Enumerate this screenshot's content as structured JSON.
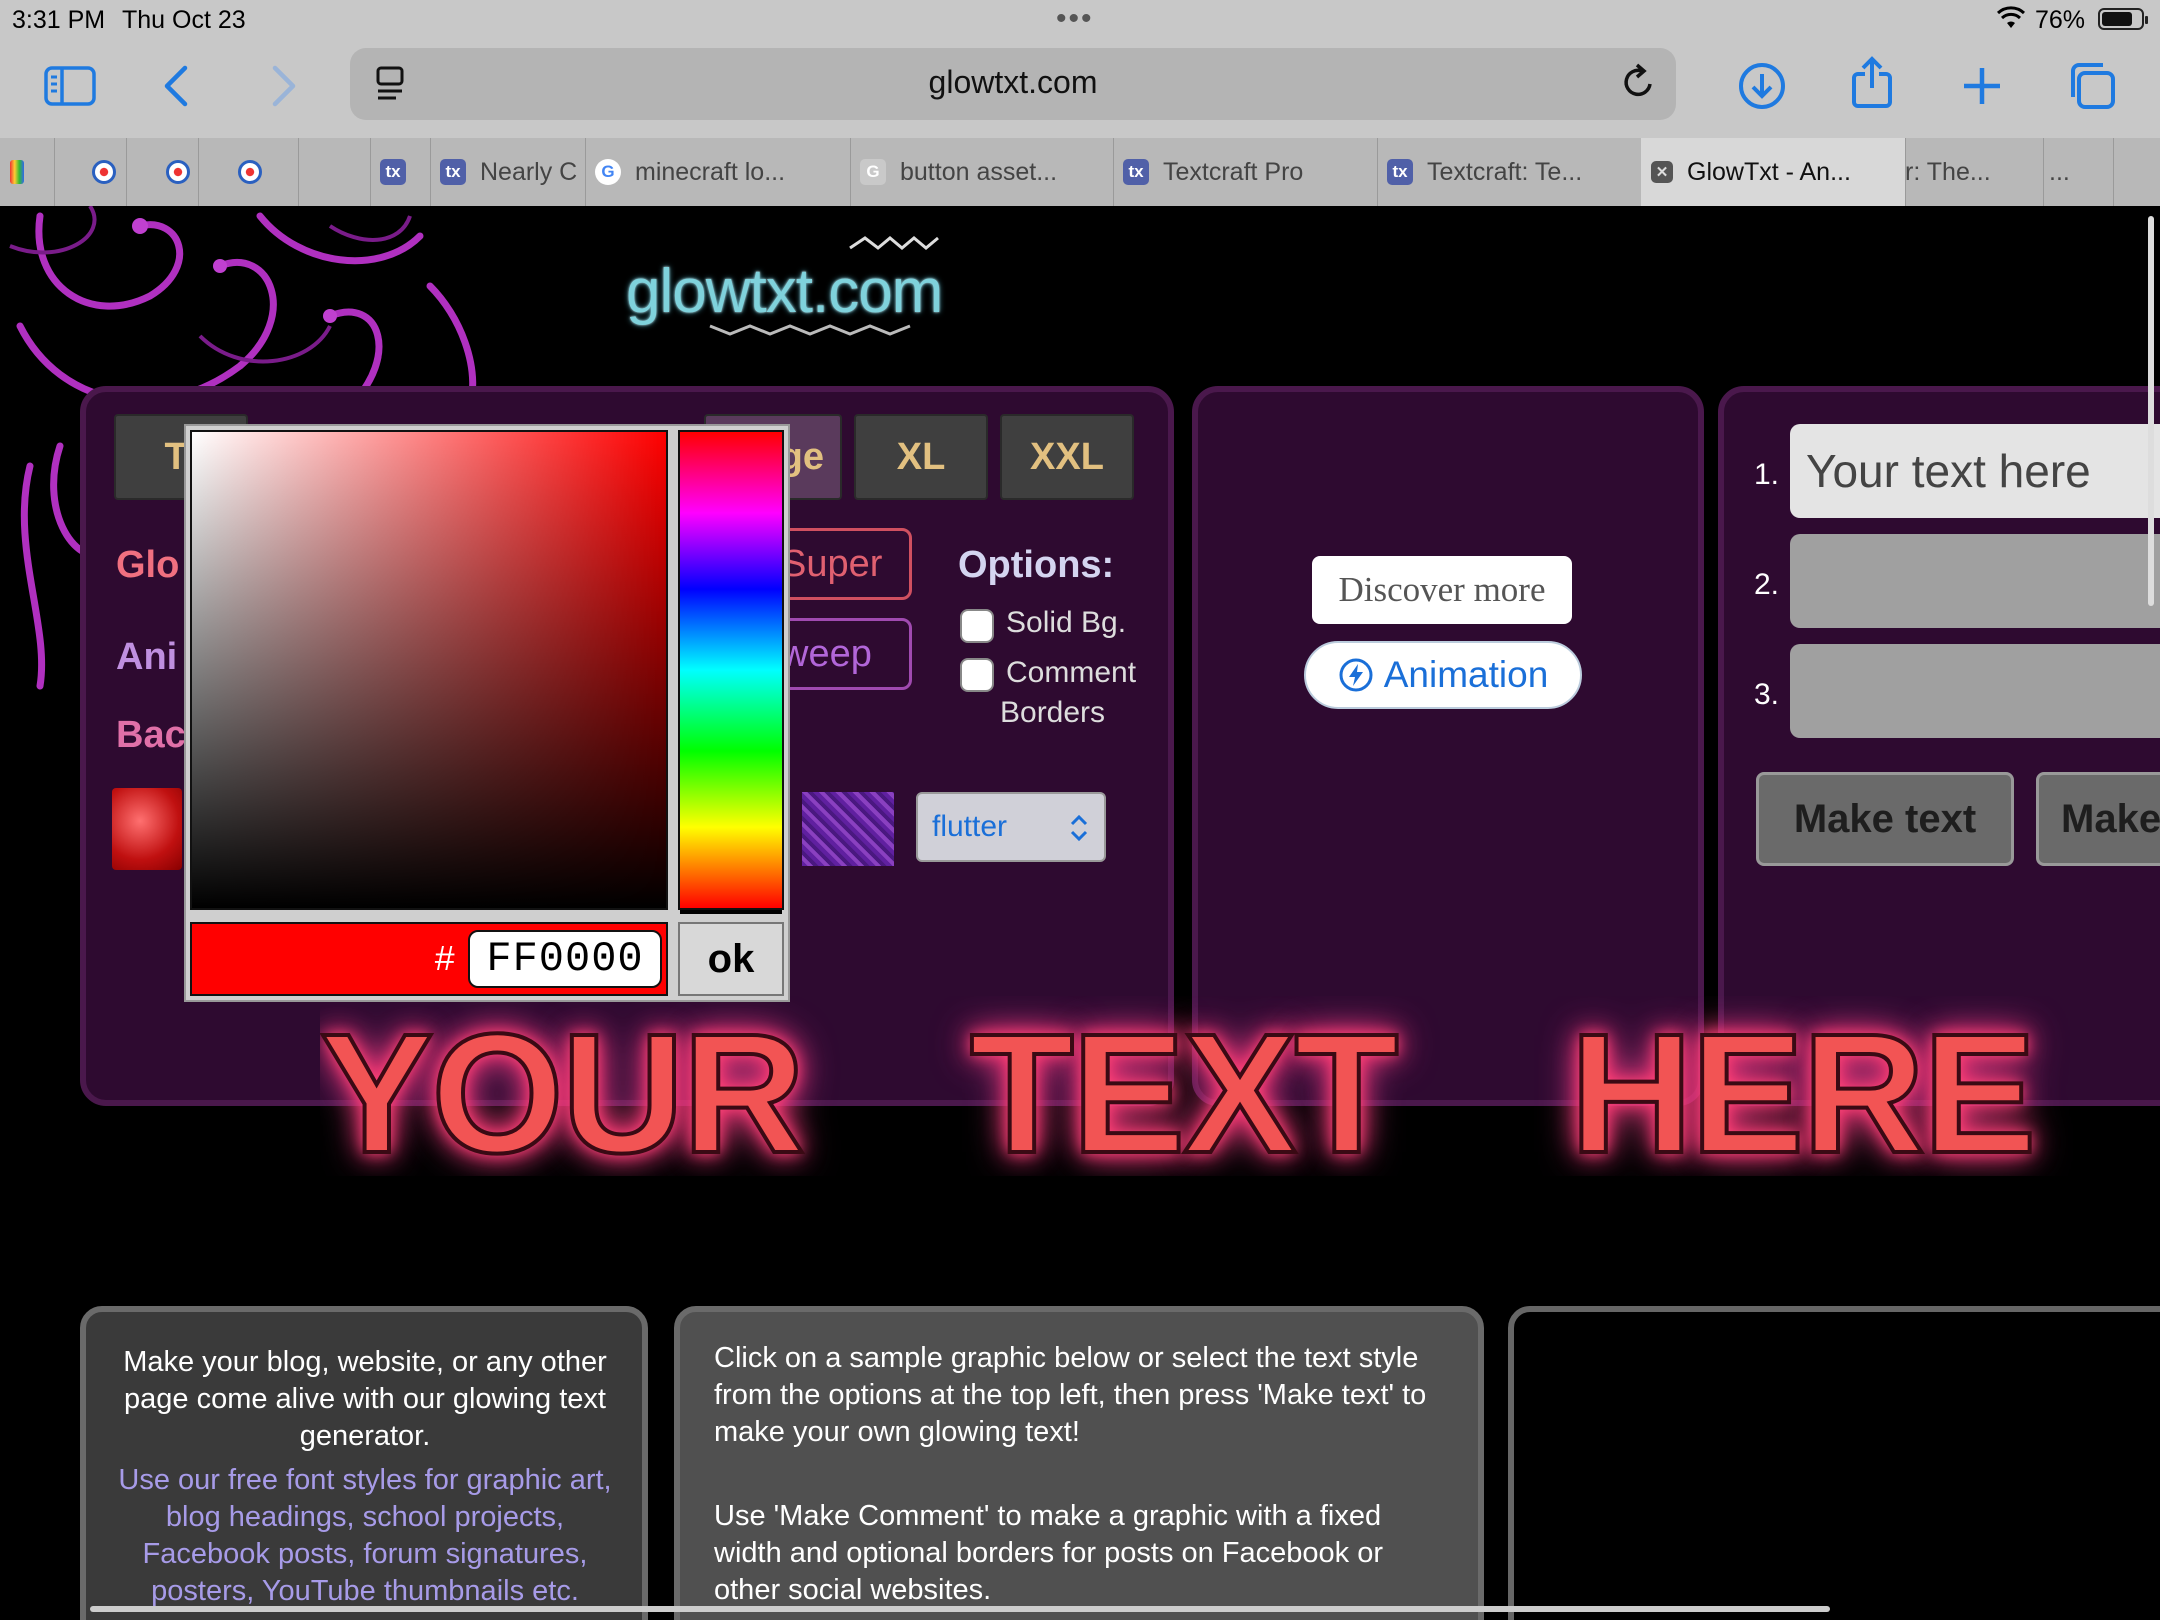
{
  "status": {
    "time": "3:31 PM",
    "date": "Thu Oct 23",
    "battery": "76%"
  },
  "browser": {
    "url": "glowtxt.com",
    "tabs": [
      {
        "label": "Nearly C",
        "icon": "textcraft-favicon"
      },
      {
        "label": "minecraft lo...",
        "icon": "google-favicon"
      },
      {
        "label": "button asset...",
        "icon": "g-favicon"
      },
      {
        "label": "Textcraft Pro",
        "icon": "textcraft-favicon"
      },
      {
        "label": "Textcraft: Te...",
        "icon": "textcraft-favicon"
      },
      {
        "label": "GlowTxt - An...",
        "icon": "close-icon",
        "active": true
      },
      {
        "label": "r: The...",
        "icon": ""
      },
      {
        "label": "...",
        "icon": ""
      }
    ]
  },
  "site": {
    "logo": "glowtxt.com",
    "sizes": [
      "Ti",
      "ge",
      "XL",
      "XXL"
    ],
    "labels": {
      "glow": "Glo",
      "anim": "Ani",
      "back": "Bac"
    },
    "styles": [
      "Super",
      "weep"
    ],
    "options": {
      "title": "Options:",
      "solid_bg": "Solid Bg.",
      "comment": "Comment",
      "borders": "Borders"
    },
    "animation_select": "flutter",
    "ad": {
      "discover": "Discover more",
      "animation": "Animation"
    },
    "inputs": [
      {
        "num": "1.",
        "value": "Your text here"
      },
      {
        "num": "2.",
        "value": ""
      },
      {
        "num": "3.",
        "value": ""
      }
    ],
    "make_text": "Make text",
    "make_comment": "Make",
    "glow_words": [
      "YOUR",
      "TEXT",
      "HERE"
    ],
    "info": {
      "left_p1": "Make your blog, website, or any other page come alive with our glowing text generator.",
      "left_p2": "Use our free font styles for graphic art, blog headings, school projects, Facebook posts, forum signatures, posters, YouTube thumbnails etc.",
      "mid_p1": "Click on a sample graphic below or select the text style from the options at the top left, then press 'Make text' to make your own glowing text!",
      "mid_p2": "Use 'Make Comment' to make a graphic with a fixed width and optional borders for posts on Facebook or other social websites."
    }
  },
  "picker": {
    "hash": "#",
    "hex": "FF0000",
    "ok": "ok",
    "color": "#FF0000"
  }
}
